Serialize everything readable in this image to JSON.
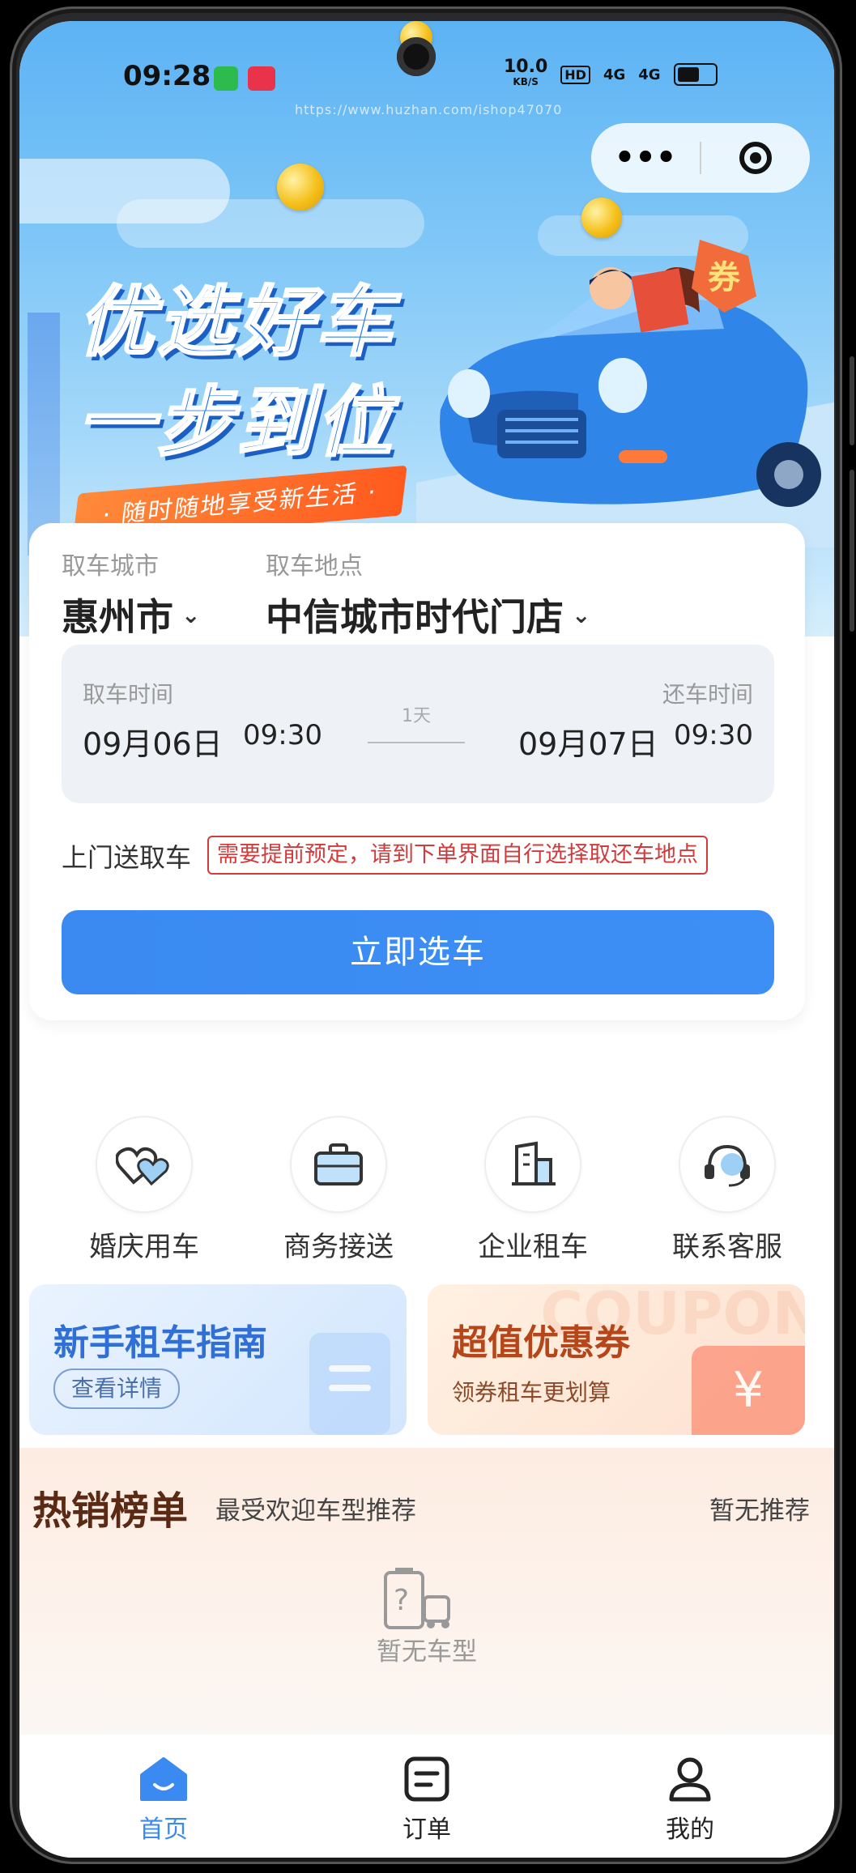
{
  "status_bar": {
    "time": "09:28",
    "speed": "10.0",
    "speed_unit": "KB/S",
    "hd": "HD",
    "net1": "4G",
    "net2": "4G"
  },
  "watermark": "https://www.huzhan.com/ishop47070",
  "hero": {
    "title_line1": "优选好车",
    "title_line2": "一步到位",
    "ribbon": "· 随时随地享受新生活 ·",
    "badge": "券"
  },
  "booking": {
    "pickup_city_label": "取车城市",
    "pickup_city": "惠州市",
    "pickup_place_label": "取车地点",
    "pickup_place": "中信城市时代门店",
    "pickup_time_label": "取车时间",
    "pickup_date": "09月06日",
    "pickup_time": "09:30",
    "duration": "1天",
    "return_time_label": "还车时间",
    "return_date": "09月07日",
    "return_time": "09:30",
    "door_service_label": "上门送取车",
    "door_service_notice": "需要提前预定，请到下单界面自行选择取还车地点",
    "cta": "立即选车"
  },
  "services": [
    {
      "label": "婚庆用车",
      "icon": "hearts-icon"
    },
    {
      "label": "商务接送",
      "icon": "briefcase-icon"
    },
    {
      "label": "企业租车",
      "icon": "building-icon"
    },
    {
      "label": "联系客服",
      "icon": "headset-icon"
    }
  ],
  "promos": {
    "guide": {
      "title": "新手租车指南",
      "button": "查看详情"
    },
    "coupon": {
      "title": "超值优惠券",
      "subtitle": "领券租车更划算",
      "bg_text": "COUPON",
      "yen": "¥"
    }
  },
  "hot_list": {
    "title": "热销榜单",
    "subtitle": "最受欢迎车型推荐",
    "right": "暂无推荐",
    "empty": "暂无车型"
  },
  "tabs": [
    {
      "label": "首页",
      "icon": "home-icon",
      "active": true
    },
    {
      "label": "订单",
      "icon": "order-icon",
      "active": false
    },
    {
      "label": "我的",
      "icon": "user-icon",
      "active": false
    }
  ],
  "colors": {
    "primary": "#3a8af1",
    "notice": "#d23b3b",
    "guide_title": "#2f6fd6",
    "coupon_title": "#b6461a",
    "hot_title": "#5a2a14"
  }
}
